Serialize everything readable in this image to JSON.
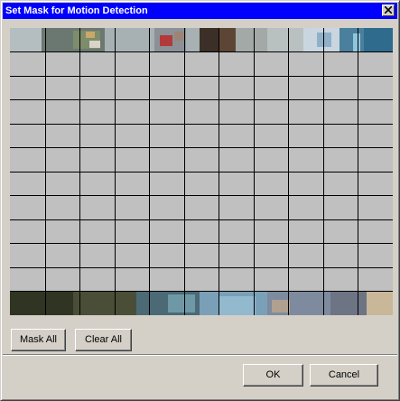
{
  "window": {
    "title": "Set Mask for Motion Detection"
  },
  "icons": {
    "close": "close-icon"
  },
  "mask_grid": {
    "columns": 11,
    "rows": 11,
    "masked_color": "#c0c0c0",
    "line_color": "#000000"
  },
  "buttons": {
    "mask_all": "Mask All",
    "clear_all": "Clear All",
    "ok": "OK",
    "cancel": "Cancel"
  },
  "colors": {
    "title_bar": "#0000ff",
    "face": "#d4d0c8"
  }
}
